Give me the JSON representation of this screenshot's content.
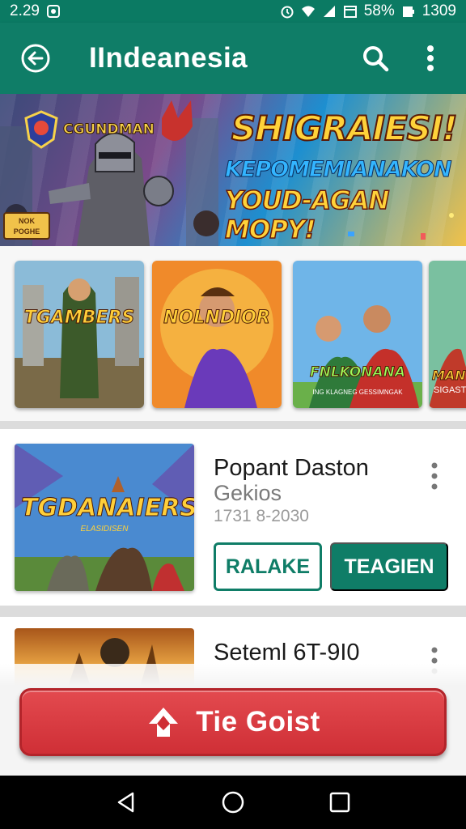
{
  "status_bar": {
    "time": "2.29",
    "battery_text": "58%",
    "clock_right": "1309",
    "icons": [
      "notification-icon",
      "alarm-icon",
      "wifi-icon",
      "signal-icon",
      "calendar-icon",
      "battery-icon"
    ]
  },
  "app_bar": {
    "title": "IIndeanesia",
    "back_icon": "back-arrow-icon",
    "search_icon": "search-icon",
    "more_icon": "more-vert-icon"
  },
  "banner": {
    "brand": "CGUNDMAN",
    "badge_line1": "NOK",
    "badge_line2": "POGHE",
    "headline_1": "SHIGRAIESI!",
    "headline_2": "KEPOMEMIANAKON",
    "headline_3": "YOUD-AGAN MOPY!"
  },
  "carousel": {
    "tiles": [
      {
        "title": "TGAMBERS",
        "subtitle": ""
      },
      {
        "title": "NOLNDIOR",
        "subtitle": ""
      },
      {
        "title": "FNLKONANA",
        "subtitle": "ING KLAGNEG GESSIMNGAK"
      },
      {
        "title": "MAN",
        "subtitle": "SIGASTI"
      }
    ]
  },
  "game_card": {
    "thumb_title": "TGDANAIERS",
    "thumb_subtitle": "ELASIDISEN",
    "title": "Popant Daston",
    "subtitle": "Gekios",
    "meta": "1731  8-2030",
    "outline_button": "RALAKE",
    "filled_button": "TEAGIEN"
  },
  "game_card_2": {
    "title": "Seteml 6T-9I0"
  },
  "cta": {
    "label": "Tie Goist"
  },
  "colors": {
    "primary": "#0f7d67",
    "cta_red": "#d6343a"
  }
}
